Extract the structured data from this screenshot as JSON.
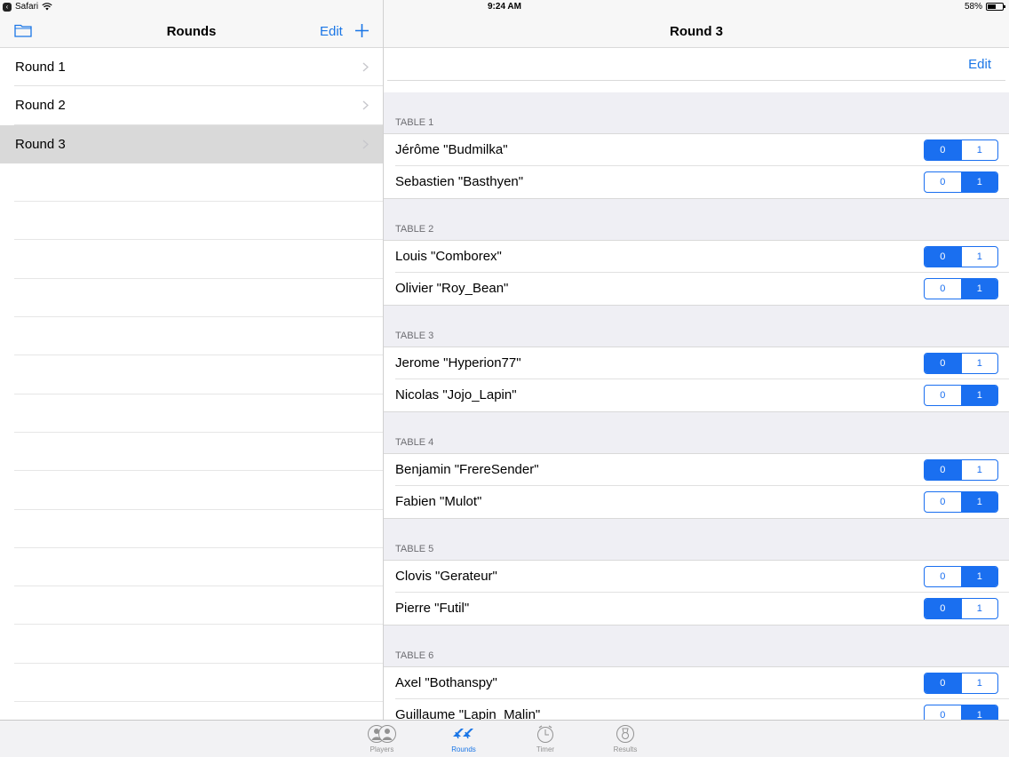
{
  "status": {
    "app": "Safari",
    "time": "9:24 AM",
    "battery": "58%",
    "battery_level": 0.58
  },
  "master": {
    "title": "Rounds",
    "edit_label": "Edit",
    "rounds": [
      {
        "label": "Round 1"
      },
      {
        "label": "Round 2"
      },
      {
        "label": "Round 3"
      }
    ],
    "selected_index": 2
  },
  "detail": {
    "title": "Round 3",
    "edit_label": "Edit",
    "tables": [
      {
        "header": "TABLE 1",
        "players": [
          {
            "name": "Jérôme \"Budmilka\"",
            "score": 0
          },
          {
            "name": "Sebastien \"Basthyen\"",
            "score": 1
          }
        ]
      },
      {
        "header": "TABLE 2",
        "players": [
          {
            "name": "Louis \"Comborex\"",
            "score": 0
          },
          {
            "name": "Olivier \"Roy_Bean\"",
            "score": 1
          }
        ]
      },
      {
        "header": "TABLE 3",
        "players": [
          {
            "name": "Jerome \"Hyperion77\"",
            "score": 0
          },
          {
            "name": "Nicolas \"Jojo_Lapin\"",
            "score": 1
          }
        ]
      },
      {
        "header": "TABLE 4",
        "players": [
          {
            "name": "Benjamin \"FrereSender\"",
            "score": 0
          },
          {
            "name": "Fabien \"Mulot\"",
            "score": 1
          }
        ]
      },
      {
        "header": "TABLE 5",
        "players": [
          {
            "name": "Clovis \"Gerateur\"",
            "score": 1
          },
          {
            "name": "Pierre \"Futil\"",
            "score": 0
          }
        ]
      },
      {
        "header": "TABLE 6",
        "players": [
          {
            "name": "Axel \"Bothanspy\"",
            "score": 0
          },
          {
            "name": "Guillaume \"Lapin_Malin\"",
            "score": 1
          }
        ]
      }
    ],
    "segment_labels": [
      "0",
      "1"
    ]
  },
  "tabbar": {
    "tabs": [
      {
        "label": "Players",
        "icon": "players-icon"
      },
      {
        "label": "Rounds",
        "icon": "rounds-icon"
      },
      {
        "label": "Timer",
        "icon": "timer-icon"
      },
      {
        "label": "Results",
        "icon": "results-icon"
      }
    ],
    "active_index": 1
  },
  "colors": {
    "accent": "#1a76e6",
    "segment": "#1a6ff0",
    "selected_row": "#d9d9d9",
    "group_bg": "#efeff4"
  }
}
